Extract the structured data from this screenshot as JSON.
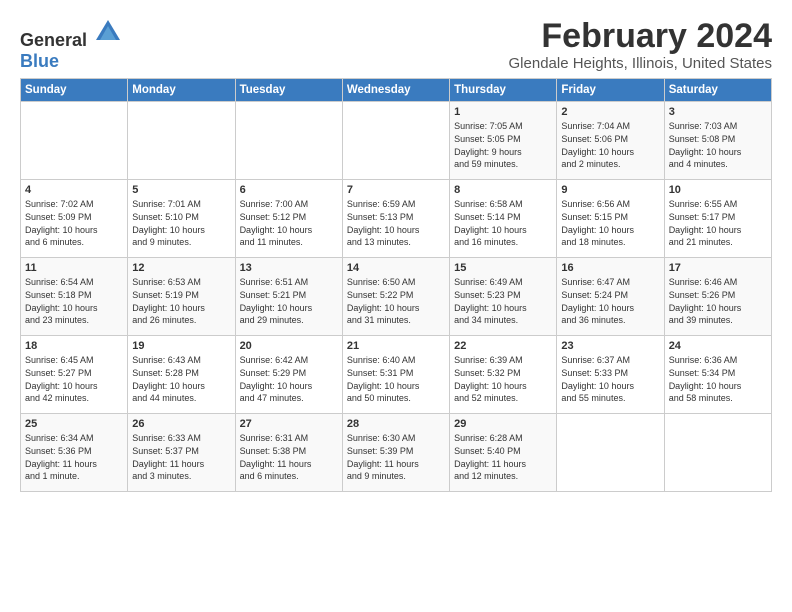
{
  "logo": {
    "general": "General",
    "blue": "Blue"
  },
  "title": "February 2024",
  "location": "Glendale Heights, Illinois, United States",
  "headers": [
    "Sunday",
    "Monday",
    "Tuesday",
    "Wednesday",
    "Thursday",
    "Friday",
    "Saturday"
  ],
  "weeks": [
    [
      {
        "day": "",
        "info": ""
      },
      {
        "day": "",
        "info": ""
      },
      {
        "day": "",
        "info": ""
      },
      {
        "day": "",
        "info": ""
      },
      {
        "day": "1",
        "info": "Sunrise: 7:05 AM\nSunset: 5:05 PM\nDaylight: 9 hours\nand 59 minutes."
      },
      {
        "day": "2",
        "info": "Sunrise: 7:04 AM\nSunset: 5:06 PM\nDaylight: 10 hours\nand 2 minutes."
      },
      {
        "day": "3",
        "info": "Sunrise: 7:03 AM\nSunset: 5:08 PM\nDaylight: 10 hours\nand 4 minutes."
      }
    ],
    [
      {
        "day": "4",
        "info": "Sunrise: 7:02 AM\nSunset: 5:09 PM\nDaylight: 10 hours\nand 6 minutes."
      },
      {
        "day": "5",
        "info": "Sunrise: 7:01 AM\nSunset: 5:10 PM\nDaylight: 10 hours\nand 9 minutes."
      },
      {
        "day": "6",
        "info": "Sunrise: 7:00 AM\nSunset: 5:12 PM\nDaylight: 10 hours\nand 11 minutes."
      },
      {
        "day": "7",
        "info": "Sunrise: 6:59 AM\nSunset: 5:13 PM\nDaylight: 10 hours\nand 13 minutes."
      },
      {
        "day": "8",
        "info": "Sunrise: 6:58 AM\nSunset: 5:14 PM\nDaylight: 10 hours\nand 16 minutes."
      },
      {
        "day": "9",
        "info": "Sunrise: 6:56 AM\nSunset: 5:15 PM\nDaylight: 10 hours\nand 18 minutes."
      },
      {
        "day": "10",
        "info": "Sunrise: 6:55 AM\nSunset: 5:17 PM\nDaylight: 10 hours\nand 21 minutes."
      }
    ],
    [
      {
        "day": "11",
        "info": "Sunrise: 6:54 AM\nSunset: 5:18 PM\nDaylight: 10 hours\nand 23 minutes."
      },
      {
        "day": "12",
        "info": "Sunrise: 6:53 AM\nSunset: 5:19 PM\nDaylight: 10 hours\nand 26 minutes."
      },
      {
        "day": "13",
        "info": "Sunrise: 6:51 AM\nSunset: 5:21 PM\nDaylight: 10 hours\nand 29 minutes."
      },
      {
        "day": "14",
        "info": "Sunrise: 6:50 AM\nSunset: 5:22 PM\nDaylight: 10 hours\nand 31 minutes."
      },
      {
        "day": "15",
        "info": "Sunrise: 6:49 AM\nSunset: 5:23 PM\nDaylight: 10 hours\nand 34 minutes."
      },
      {
        "day": "16",
        "info": "Sunrise: 6:47 AM\nSunset: 5:24 PM\nDaylight: 10 hours\nand 36 minutes."
      },
      {
        "day": "17",
        "info": "Sunrise: 6:46 AM\nSunset: 5:26 PM\nDaylight: 10 hours\nand 39 minutes."
      }
    ],
    [
      {
        "day": "18",
        "info": "Sunrise: 6:45 AM\nSunset: 5:27 PM\nDaylight: 10 hours\nand 42 minutes."
      },
      {
        "day": "19",
        "info": "Sunrise: 6:43 AM\nSunset: 5:28 PM\nDaylight: 10 hours\nand 44 minutes."
      },
      {
        "day": "20",
        "info": "Sunrise: 6:42 AM\nSunset: 5:29 PM\nDaylight: 10 hours\nand 47 minutes."
      },
      {
        "day": "21",
        "info": "Sunrise: 6:40 AM\nSunset: 5:31 PM\nDaylight: 10 hours\nand 50 minutes."
      },
      {
        "day": "22",
        "info": "Sunrise: 6:39 AM\nSunset: 5:32 PM\nDaylight: 10 hours\nand 52 minutes."
      },
      {
        "day": "23",
        "info": "Sunrise: 6:37 AM\nSunset: 5:33 PM\nDaylight: 10 hours\nand 55 minutes."
      },
      {
        "day": "24",
        "info": "Sunrise: 6:36 AM\nSunset: 5:34 PM\nDaylight: 10 hours\nand 58 minutes."
      }
    ],
    [
      {
        "day": "25",
        "info": "Sunrise: 6:34 AM\nSunset: 5:36 PM\nDaylight: 11 hours\nand 1 minute."
      },
      {
        "day": "26",
        "info": "Sunrise: 6:33 AM\nSunset: 5:37 PM\nDaylight: 11 hours\nand 3 minutes."
      },
      {
        "day": "27",
        "info": "Sunrise: 6:31 AM\nSunset: 5:38 PM\nDaylight: 11 hours\nand 6 minutes."
      },
      {
        "day": "28",
        "info": "Sunrise: 6:30 AM\nSunset: 5:39 PM\nDaylight: 11 hours\nand 9 minutes."
      },
      {
        "day": "29",
        "info": "Sunrise: 6:28 AM\nSunset: 5:40 PM\nDaylight: 11 hours\nand 12 minutes."
      },
      {
        "day": "",
        "info": ""
      },
      {
        "day": "",
        "info": ""
      }
    ]
  ]
}
